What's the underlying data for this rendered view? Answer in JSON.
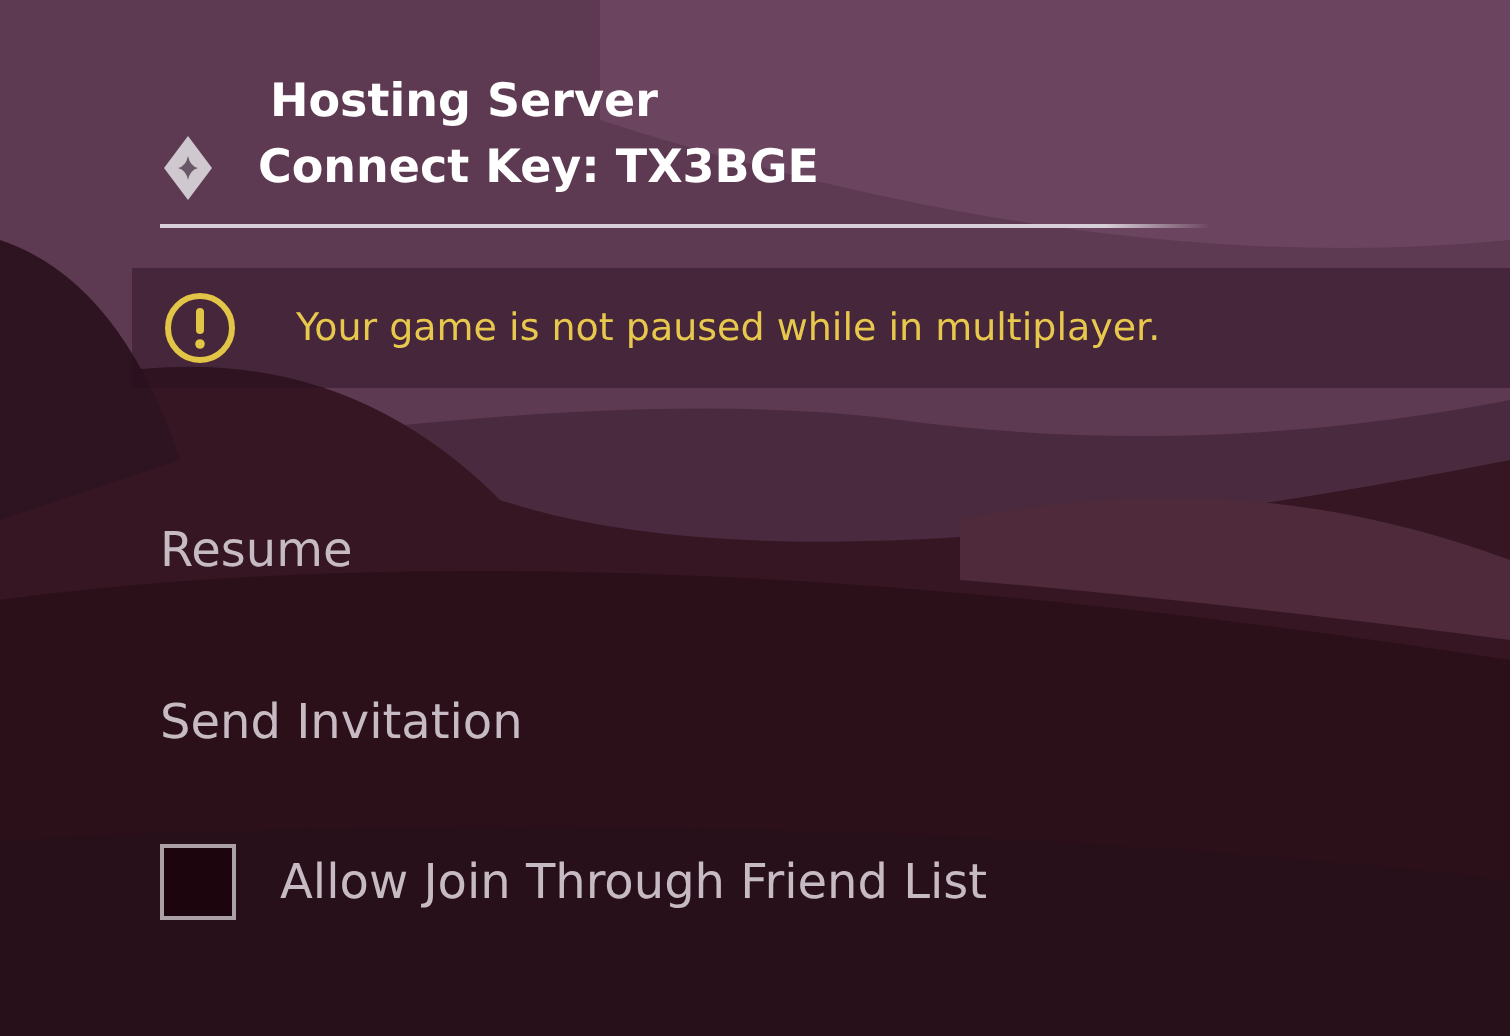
{
  "header": {
    "title": "Hosting Server",
    "connect_key": "Connect Key: TX3BGE"
  },
  "notice": {
    "text": "Your game is not paused while in multiplayer."
  },
  "menu": [
    {
      "kind": "button",
      "label": "Resume"
    },
    {
      "kind": "button",
      "label": "Send Invitation"
    },
    {
      "kind": "checkbox",
      "label": "Allow Join Through Friend List",
      "checked": false
    }
  ]
}
